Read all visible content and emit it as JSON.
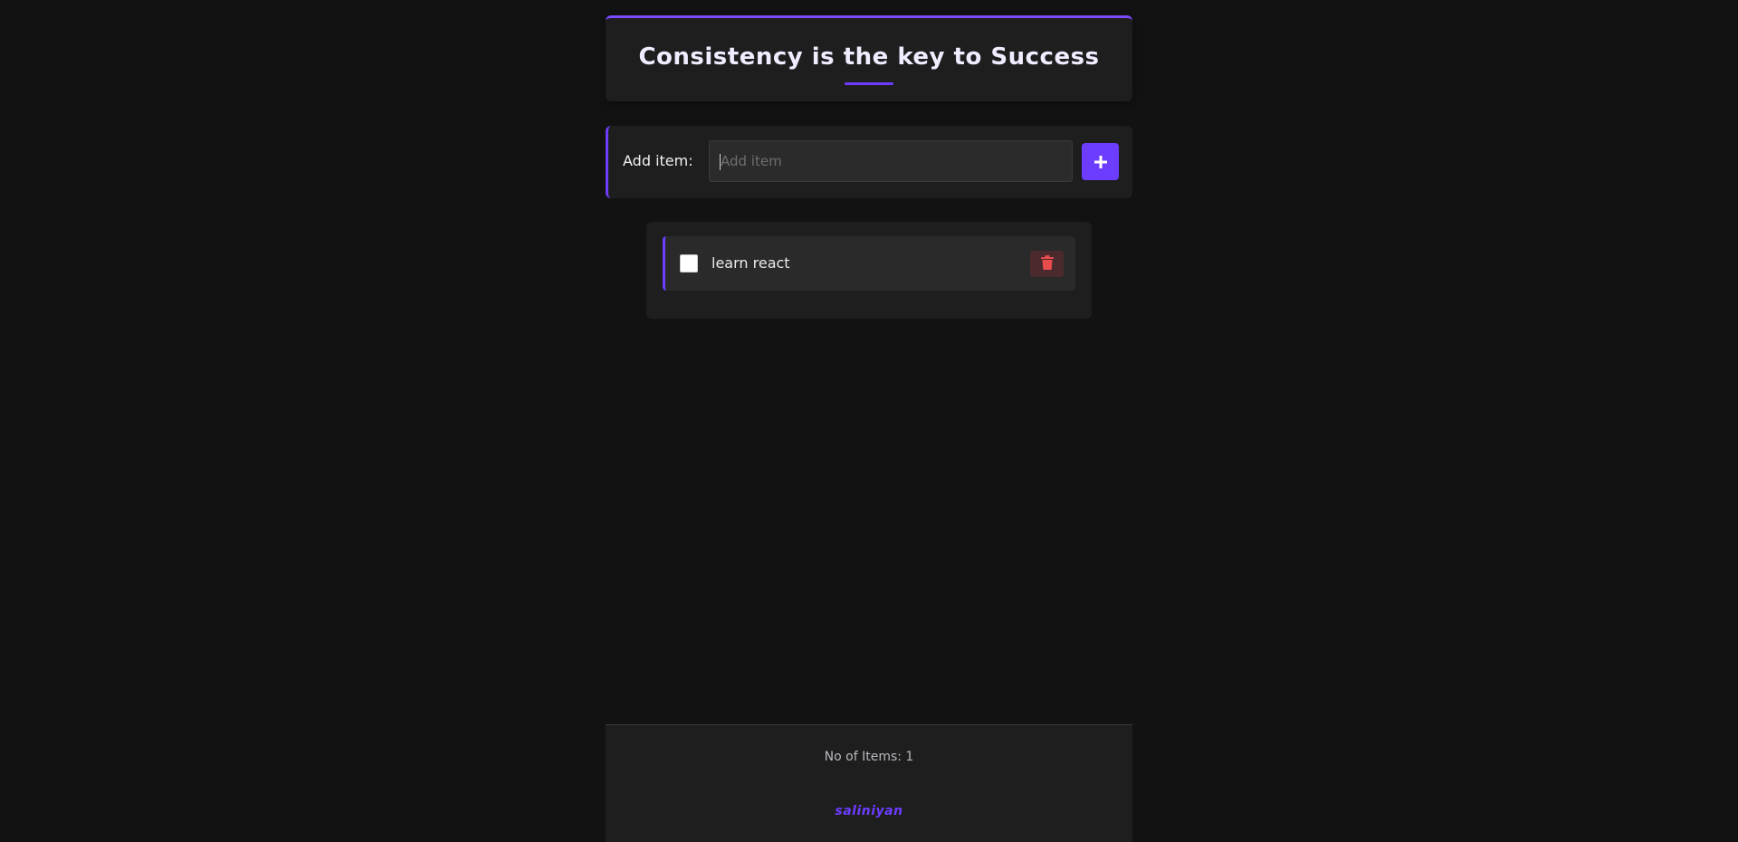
{
  "header": {
    "title": "Consistency is the key to Success"
  },
  "add_item": {
    "label": "Add item:",
    "placeholder": "Add item",
    "value": "",
    "button_icon": "plus-icon"
  },
  "items": [
    {
      "text": "learn react",
      "checked": false,
      "delete_icon": "trash-icon"
    }
  ],
  "footer": {
    "count_text": "No of Items: 1",
    "author": "saliniyan"
  },
  "colors": {
    "accent": "#6d3dff",
    "background": "#121212",
    "panel": "#1e1e1f",
    "delete": "#e84c4c"
  }
}
